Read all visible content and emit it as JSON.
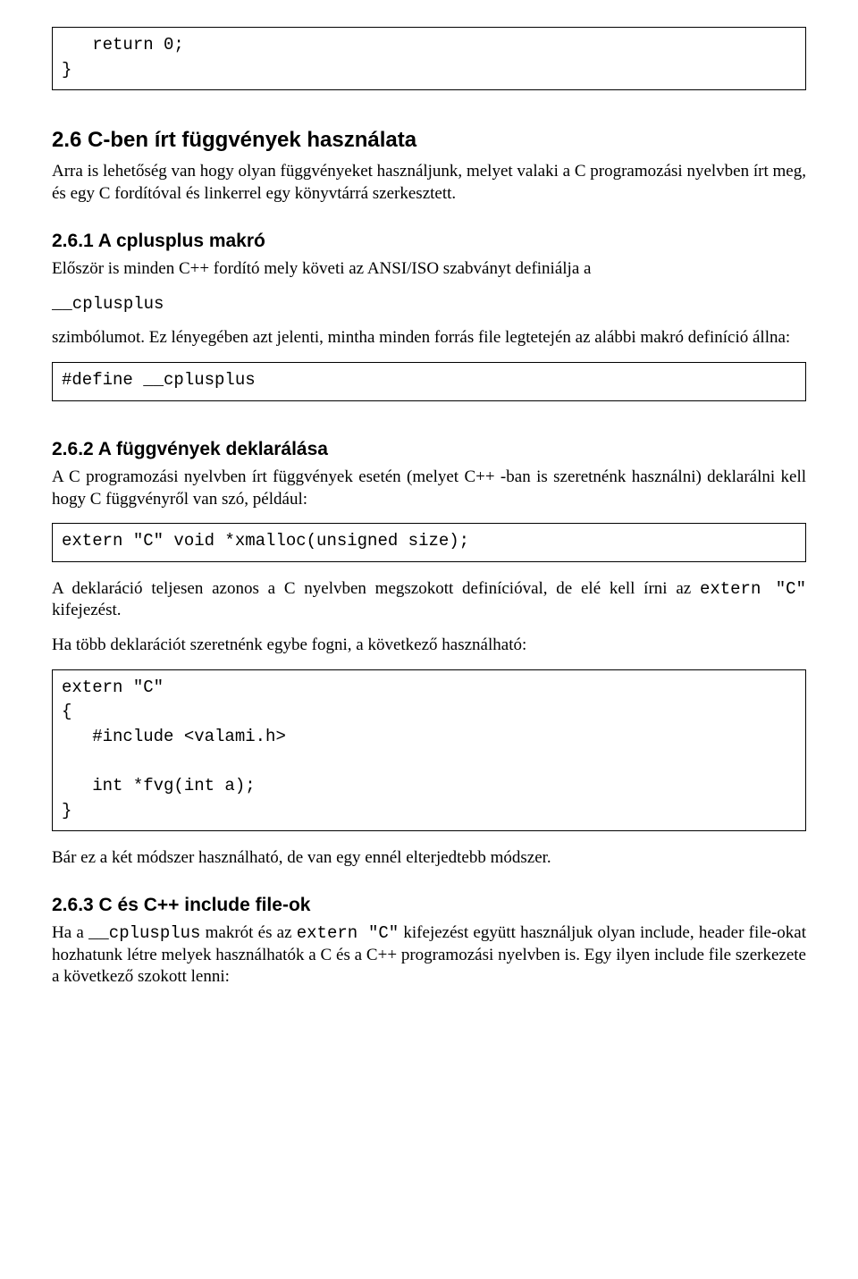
{
  "code1": "   return 0;\n}",
  "sec26": {
    "title": "2.6 C-ben írt függvények használata",
    "para": "Arra is lehetőség van hogy olyan függvényeket használjunk, melyet valaki a C programozási nyelvben írt meg, és egy C fordítóval és linkerrel egy könyvtárrá szerkesztett."
  },
  "sec261": {
    "title": "2.6.1 A cplusplus makró",
    "para1": "Először is minden C++ fordító mely követi az ANSI/ISO szabványt definiálja a",
    "symbol": "__cplusplus",
    "para2": "szimbólumot. Ez lényegében azt jelenti, mintha minden forrás file legtetején az alábbi makró definíció állna:",
    "code": "#define __cplusplus"
  },
  "sec262": {
    "title": "2.6.2 A függvények deklarálása",
    "para1": "A C programozási nyelvben írt függvények esetén (melyet C++ -ban is szeretnénk használni) deklarálni kell hogy C függvényről van szó, például:",
    "code1": "extern \"C\" void *xmalloc(unsigned size);",
    "para2a": "A deklaráció teljesen azonos a C nyelvben megszokott definícióval, de elé kell írni az ",
    "extern_c": "extern \"C\" ",
    "para2b": " kifejezést.",
    "para3": "Ha több deklarációt szeretnénk egybe fogni, a következő használható:",
    "code2": "extern \"C\"\n{\n   #include <valami.h>\n\n   int *fvg(int a);\n}",
    "para4": "Bár ez a két módszer használható, de van egy ennél elterjedtebb módszer."
  },
  "sec263": {
    "title": "2.6.3 C és C++ include file-ok",
    "para_a": "Ha a ",
    "cplusplus": "__cplusplus",
    "para_b": " makrót és az ",
    "externc2": "extern \"C\"",
    "para_c": " kifejezést együtt használjuk olyan include, header file-okat hozhatunk létre melyek használhatók a C és a C++ programozási nyelvben is. Egy ilyen include file szerkezete a következő szokott lenni:"
  }
}
